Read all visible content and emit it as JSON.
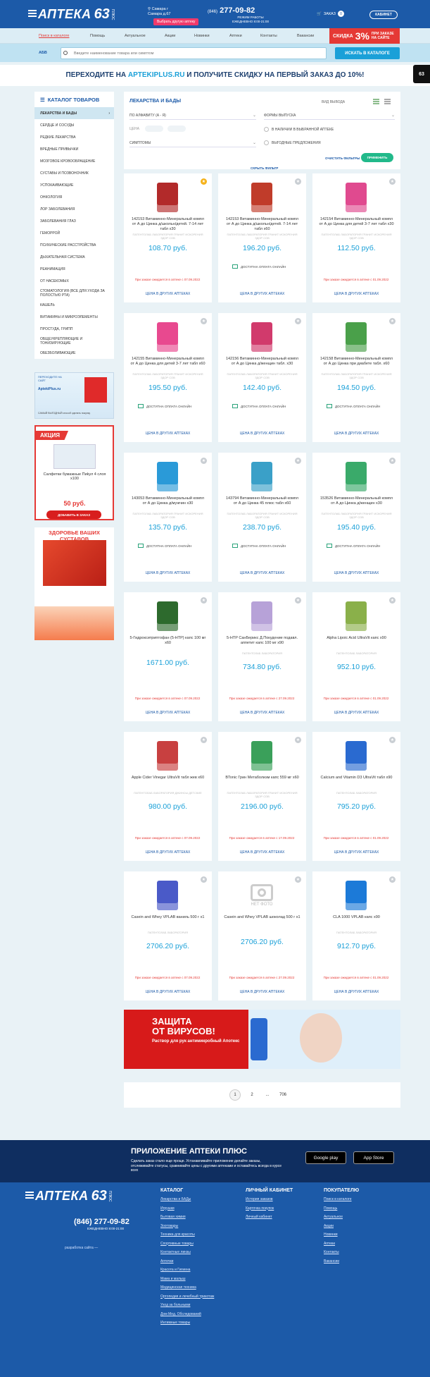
{
  "header": {
    "logo_word": "АПТЕКА",
    "logo_num": "63",
    "logo_plus": "ПЛЮС",
    "city": "Самара г",
    "city_sub": "Самара д.67",
    "other_pharm": "Выбрать другую аптеку",
    "phone_code": "(846)",
    "phone": "277-09-82",
    "work_mode": "РЕЖИМ РАБОТЫ",
    "work_hours": "ЕЖЕДНЕВНО 8:00-21:00",
    "cart_label": "ЗАКАЗ",
    "cart_count": "0",
    "cabinet": "КАБИНЕТ"
  },
  "nav": {
    "items": [
      "Поиск в каталоге",
      "Помощь",
      "Актуальное",
      "Акции",
      "Новинки",
      "Аптеки",
      "Контакты",
      "Вакансии"
    ]
  },
  "promo": {
    "label": "СКИДКА",
    "percent": "3%",
    "text": "ПРИ ЗАКАЗЕ НА САЙТЕ"
  },
  "search": {
    "abc": "АБВ",
    "placeholder": "Введите наименование товара или симптом",
    "button": "ИСКАТЬ В КАТАЛОГЕ"
  },
  "banner": {
    "pre": "ПЕРЕХОДИТЕ НА ",
    "site": "APTEKIPLUS.RU",
    "post": " И ПОЛУЧИТЕ СКИДКУ НА ПЕРВЫЙ ЗАКАЗ ДО 10%!"
  },
  "eye_label": "63",
  "sidebar": {
    "title": "КАТАЛОГ ТОВАРОВ",
    "items": [
      "ЛЕКАРСТВА И БАДЫ",
      "СЕРДЦЕ И СОСУДЫ",
      "РЕДКИЕ ЛЕКАРСТВА",
      "ВРЕДНЫЕ ПРИВЫЧКИ",
      "МОЗГОВОЕ КРОВООБРАЩЕНИЕ",
      "СУСТАВЫ И ПОЗВОНОЧНИК",
      "УСПОКАИВАЮЩИЕ",
      "ОНКОЛОГИЯ",
      "ЛОР ЗАБОЛЕВАНИЯ",
      "ЗАБОЛЕВАНИЯ ГЛАЗ",
      "ГЕМОРРОЙ",
      "ПСИХИЧЕСКИЕ РАССТРОЙСТВА",
      "ДЫХАТЕЛЬНАЯ СИСТЕМА",
      "РЕАНИМАЦИЯ",
      "ОТ НАСЕКОМЫХ",
      "СТОМАТОЛОГИЯ (ВСЕ ДЛЯ УХОДА ЗА ПОЛОСТЬЮ РТА)",
      "КАШЕЛЬ",
      "ВИТАМИНЫ И МИКРОЭЛЕМЕНТЫ",
      "ПРОСТУДА, ГРИПП",
      "ОБЩЕУКРЕПЛЯЮЩИЕ И ТОНИЗИРУЮЩИЕ",
      "ОБЕЗБОЛИВАЮЩИЕ"
    ]
  },
  "ads": {
    "app_top": "ПЕРЕХОДИТЕ НА САЙТ",
    "app_site": "AptekiPlus.ru",
    "app_bottom": "САМЫЙ ВЫГОДНЫЙ способ сделать покупку",
    "sale_tag": "АКЦИЯ",
    "sale_name": "Салфетки бумажные Пиkул 4 слоя х100",
    "sale_price": "50 руб.",
    "sale_btn": "ДОБАВИТЬ В ЗАКАЗ",
    "joint_title": "ЗДОРОВЬЕ ВАШИХ СУСТАВОВ"
  },
  "filter": {
    "title": "ЛЕКАРСТВА И БАДЫ",
    "view": "ВИД ВЫВОДА",
    "sort": "ПО АЛФАВИТУ  (А - Я)",
    "forms": "ФОРМЫ ВЫПУСКА",
    "price": "ЦЕНА",
    "symptoms": "СИМПТОМЫ",
    "in_stock": "В НАЛИЧИИ В ВЫБРАННОЙ АПТЕКЕ",
    "deals": "ВЫГОДНЫЕ ПРЕДЛОЖЕНИЯ",
    "clear": "ОЧИСТИТЬ ФИЛЬТРЫ",
    "apply": "ПРИМЕНИТЬ",
    "reset": "СКРЫТЬ ФИЛЬТР"
  },
  "products": [
    {
      "name": "142153 Витаминно-Минеральный компл от А до Цинка д/школьн/детей. 7-14 лет табл х30",
      "maker": "ПАТЕНТОЛАБ ЛАБОРАТОРИЯ ГРАНИТ ИСКОРЕНИЯ ЗДОР СОВ",
      "price": "108.70 руб.",
      "status": "При заказе ожидается в аптеке с 07.09.2022",
      "other": "ЦЕНА В ДРУГИХ АПТЕКАХ",
      "color": "#b22a2a",
      "gold": true
    },
    {
      "name": "142153 Витаминно-Минеральный компл от А до Цинка д/школьн/детей. 7-14 лет табл х60",
      "maker": "ПАТЕНТОЛАБ ЛАБОРАТОРИЯ ГРАНИТ ИСКОРЕНИЯ ЗДОР СОВ",
      "price": "196.20 руб.",
      "status": "ДОСТУПНА ОПЛАТА ОНЛАЙН",
      "other": "ЦЕНА В ДРУГИХ АПТЕКАХ",
      "color": "#c03c2a",
      "online": true
    },
    {
      "name": "142154 Витаминно-Минеральный компл от А до Цинка для детей 3-7 лет табл х30",
      "maker": "ПАТЕНТОЛАБ ЛАБОРАТОРИЯ ГРАНИТ ИСКОРЕНИЯ ЗДОР СОВ",
      "price": "112.50 руб.",
      "status": "При заказе ожидается в аптеке с 01.09.2022",
      "other": "ЦЕНА В ДРУГИХ АПТЕКАХ",
      "color": "#e04a8f"
    },
    {
      "name": "142155 Витаминно-Минеральный компл от А до Цинка для детей 3-7 лет табл х60",
      "maker": "ПАТЕНТОЛАБ ЛАБОРАТОРИЯ ГРАНИТ ИСКОРЕНИЯ ЗДОР СОВ",
      "price": "195.50 руб.",
      "status": "ДОСТУПНА ОПЛАТА ОНЛАЙН",
      "other": "ЦЕНА В ДРУГИХ АПТЕКАХ",
      "color": "#e8498f",
      "online": true
    },
    {
      "name": "142156 Витаминно-Минеральный компл от А до Цинка д/женщин табл. х30",
      "maker": "ПАТЕНТОЛАБ ЛАБОРАТОРИЯ ГРАНИТ ИСКОРЕНИЯ ЗДОР СОВ",
      "price": "142.40 руб.",
      "status": "ДОСТУПНА ОПЛАТА ОНЛАЙН",
      "other": "ЦЕНА В ДРУГИХ АПТЕКАХ",
      "color": "#d13a6c",
      "online": true
    },
    {
      "name": "142158 Витаминно-Минеральный компл от А до Цинка при диабете табл. х60",
      "maker": "ПАТЕНТОЛАБ ЛАБОРАТОРИЯ ГРАНИТ ИСКОРЕНИЯ ЗДОР СОВ",
      "price": "194.50 руб.",
      "status": "ДОСТУПНА ОПЛАТА ОНЛАЙН",
      "other": "ЦЕНА В ДРУГИХ АПТЕКАХ",
      "color": "#4aa04a",
      "online": true
    },
    {
      "name": "143053 Витаминно-Минеральный компл от А до Цинка д/мужчин х30",
      "maker": "ПАТЕНТОЛАБ ЛАБОРАТОРИЯ ГРАНИТ ИСКОРЕНИЯ ЗДОР СОВ",
      "price": "135.70 руб.",
      "status": "ДОСТУПНА ОПЛАТА ОНЛАЙН",
      "other": "ЦЕНА В ДРУГИХ АПТЕКАХ",
      "color": "#2a9ad8",
      "online": true
    },
    {
      "name": "143794 Витаминно-Минеральный компл от А до Цинка 45 плюс табл х60",
      "maker": "ПАТЕНТОЛАБ ЛАБОРАТОРИЯ ГРАНИТ ИСКОРЕНИЯ ЗДОР СОВ",
      "price": "238.70 руб.",
      "status": "ДОСТУПНА ОПЛАТА ОНЛАЙН",
      "other": "ЦЕНА В ДРУГИХ АПТЕКАХ",
      "color": "#3aa0c8",
      "online": true
    },
    {
      "name": "153526 Витаминно-Минеральный компл от А до Цинка д/женщин х30",
      "maker": "ПАТЕНТОЛАБ ЛАБОРАТОРИЯ ГРАНИТ ИСКОРЕНИЯ ЗДОР СОВ",
      "price": "195.40 руб.",
      "status": "ДОСТУПНА ОПЛАТА ОНЛАЙН",
      "other": "ЦЕНА В ДРУГИХ АПТЕКАХ",
      "color": "#3aaa6a",
      "online": true
    },
    {
      "name": "5-Гидрокситриптофан (5-HTP) капс 100 мг х60",
      "maker": "",
      "price": "1671.00 руб.",
      "status": "При заказе ожидается в аптеке с 07.09.2022",
      "other": "ЦЕНА В ДРУГИХ АПТЕКАХ",
      "color": "#2d6a2d"
    },
    {
      "name": "5-HTP СанБерикс Д.Покудение подавл. аппетит капс 100 мг х90",
      "maker": "ПАТЕНТОЛАБ ЛАБОРАТОРИЯ",
      "price": "734.80 руб.",
      "status": "При заказе ожидается в аптеке с 27.09.2022",
      "other": "ЦЕНА В ДРУГИХ АПТЕКАХ",
      "color": "#b7a2d8"
    },
    {
      "name": "Alpha Lipoic Acid UltraVit капс х90",
      "maker": "ПАТЕНТОЛАБ ЛАБОРАТОРИЯ",
      "price": "952.10 руб.",
      "status": "При заказе ожидается в аптеке с 01.09.2022",
      "other": "ЦЕНА В ДРУГИХ АПТЕКАХ",
      "color": "#8ab04a"
    },
    {
      "name": "Apple Cider Vinegar UltraVit табл жев х60",
      "maker": "ПАТЕНТОЛАБ ЛАБОРАТОРИЯ ДЖИНСЫ ДЕТСКИЕ",
      "price": "980.00 руб.",
      "status": "При заказе ожидается в аптеке с 07.09.2022",
      "other": "ЦЕНА В ДРУГИХ АПТЕКАХ",
      "color": "#c84040"
    },
    {
      "name": "BTonic Грин Метаболизм капс 559 мг х60",
      "maker": "ПАТЕНТОЛАБ ЛАБОРАТОРИЯ ГРАНИТ ИСКОРЕНИЯ ЗДОР СОВ",
      "price": "2196.00 руб.",
      "status": "При заказе ожидается в аптеке с 17.09.2022",
      "other": "ЦЕНА В ДРУГИХ АПТЕКАХ",
      "color": "#3aa05a"
    },
    {
      "name": "Calcium and Vitamin D3 UltraVit табл х90",
      "maker": "ПАТЕНТОЛАБ ЛАБОРАТОРИЯ",
      "price": "795.20 руб.",
      "status": "При заказе ожидается в аптеке с 01.09.2022",
      "other": "ЦЕНА В ДРУГИХ АПТЕКАХ",
      "color": "#2a6ad0"
    },
    {
      "name": "Casein and Whey VPLAB ваниль 500 г х1",
      "maker": "ПАТЕНТОЛАБ ЛАБОРАТОРИЯ",
      "price": "2706.20 руб.",
      "status": "При заказе ожидается в аптеке с 07.09.2022",
      "other": "ЦЕНА В ДРУГИХ АПТЕКАХ",
      "color": "#4a5ac8"
    },
    {
      "name": "Casein and Whey VPLAB шоколад 500 г х1",
      "maker": "",
      "price": "2706.20 руб.",
      "status": "При заказе ожидается в аптеке с 27.09.2022",
      "other": "ЦЕНА В ДРУГИХ АПТЕКАХ",
      "color": "",
      "nophoto": "НЕТ ФОТО"
    },
    {
      "name": "CLA 1000 VPLAB капс х90",
      "maker": "ПАТЕНТОЛАБ ЛАБОРАТОРИЯ",
      "price": "912.70 руб.",
      "status": "При заказе ожидается в аптеке с 01.09.2022",
      "other": "ЦЕНА В ДРУГИХ АПТЕКАХ",
      "color": "#1c7ad8"
    }
  ],
  "virus": {
    "title1": "ЗАЩИТА",
    "title2": "ОТ ВИРУСОВ!",
    "sub": "Раствор для рук антимикробный Апотекс"
  },
  "pagination": {
    "pages": [
      "1",
      "2",
      "...",
      "706"
    ]
  },
  "app": {
    "title": "ПРИЛОЖЕНИЕ АПТЕКИ ПЛЮС",
    "desc": "Сделать заказ стало еще проще. Устанавливайте приложение делайте заказы, отслеживайте статусы, сравнивайте цены с другими аптеками и оставайтесь всегда в курсе всех",
    "gplay": "Google play",
    "appstore": "App Store"
  },
  "footer": {
    "phone": "(846) 277-09-82",
    "work": "ЕЖЕДНЕВНО 8:00-21:00",
    "dev": "разработка сайта —",
    "catalog_h": "КАТАЛОГ",
    "catalog": [
      "Лекарства и БАДы",
      "Игрушки",
      "Бытовая химия",
      "Зоотовары",
      "Техника для красоты",
      "Спортивные товары",
      "Контактные линзы",
      "Аптечки",
      "Красота и Гигиена",
      "Мама и малыш",
      "Медицинская техника",
      "Ортопедия и лечебный трикотаж",
      "Уход за больными",
      "Дом Мед. Обследований",
      "Интимные товары"
    ],
    "cabinet_h": "ЛИЧНЫЙ КАБИНЕТ",
    "cabinet": [
      "История заказов",
      "Карточка покупок",
      "Личный кабинет"
    ],
    "buyer_h": "ПОКУПАТЕЛЮ",
    "buyer": [
      "Поиск в каталоге",
      "Помощь",
      "Актуальное",
      "Акции",
      "Новинки",
      "Аптеки",
      "Контакты",
      "Вакансии"
    ]
  }
}
